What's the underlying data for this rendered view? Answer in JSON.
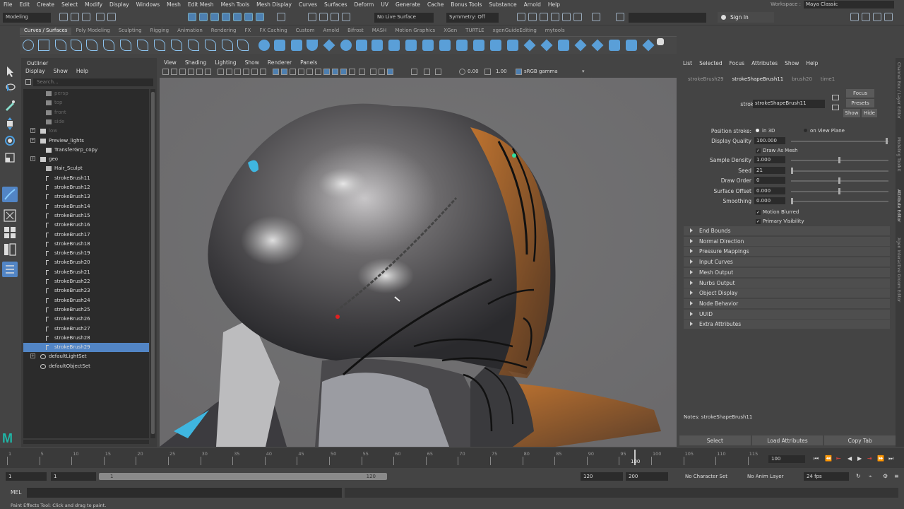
{
  "menubar": [
    "File",
    "Edit",
    "Create",
    "Select",
    "Modify",
    "Display",
    "Windows",
    "Mesh",
    "Edit Mesh",
    "Mesh Tools",
    "Mesh Display",
    "Curves",
    "Surfaces",
    "Deform",
    "UV",
    "Generate",
    "Cache",
    "Bonus Tools",
    "Substance",
    "Arnold",
    "Help"
  ],
  "workspace": {
    "label": "Workspace :",
    "value": "Maya Classic"
  },
  "status": {
    "mode": "Modeling",
    "live_surface": "No Live Surface",
    "symmetry": "Symmetry: Off",
    "signin": "Sign In"
  },
  "shelf_tabs": [
    "Curves / Surfaces",
    "Poly Modeling",
    "Sculpting",
    "Rigging",
    "Animation",
    "Rendering",
    "FX",
    "FX Caching",
    "Custom",
    "Arnold",
    "Bifrost",
    "MASH",
    "Motion Graphics",
    "XGen",
    "TURTLE",
    "xgenGuideEditing",
    "mytools"
  ],
  "outliner": {
    "title": "Outliner",
    "menu": [
      "Display",
      "Show",
      "Help"
    ],
    "search_placeholder": "Search...",
    "items": [
      {
        "label": "persp",
        "dim": true,
        "indent": 1,
        "icon": "camera"
      },
      {
        "label": "top",
        "dim": true,
        "indent": 1,
        "icon": "camera"
      },
      {
        "label": "front",
        "dim": true,
        "indent": 1,
        "icon": "camera"
      },
      {
        "label": "side",
        "dim": true,
        "indent": 1,
        "icon": "camera"
      },
      {
        "label": "low",
        "dim": true,
        "indent": 0,
        "icon": "group",
        "expand": true
      },
      {
        "label": "Preview_lights",
        "dim": false,
        "indent": 0,
        "icon": "group",
        "expand": true
      },
      {
        "label": "TransferGrp_copy",
        "dim": false,
        "indent": 1,
        "icon": "group"
      },
      {
        "label": "geo",
        "dim": false,
        "indent": 0,
        "icon": "group",
        "expand": true
      },
      {
        "label": "Hair_Sculpt",
        "dim": false,
        "indent": 1,
        "icon": "transform"
      },
      {
        "label": "strokeBrush11",
        "dim": false,
        "indent": 1,
        "icon": "stroke"
      },
      {
        "label": "strokeBrush12",
        "dim": false,
        "indent": 1,
        "icon": "stroke"
      },
      {
        "label": "strokeBrush13",
        "dim": false,
        "indent": 1,
        "icon": "stroke"
      },
      {
        "label": "strokeBrush14",
        "dim": false,
        "indent": 1,
        "icon": "stroke"
      },
      {
        "label": "strokeBrush15",
        "dim": false,
        "indent": 1,
        "icon": "stroke"
      },
      {
        "label": "strokeBrush16",
        "dim": false,
        "indent": 1,
        "icon": "stroke"
      },
      {
        "label": "strokeBrush17",
        "dim": false,
        "indent": 1,
        "icon": "stroke"
      },
      {
        "label": "strokeBrush18",
        "dim": false,
        "indent": 1,
        "icon": "stroke"
      },
      {
        "label": "strokeBrush19",
        "dim": false,
        "indent": 1,
        "icon": "stroke"
      },
      {
        "label": "strokeBrush20",
        "dim": false,
        "indent": 1,
        "icon": "stroke"
      },
      {
        "label": "strokeBrush21",
        "dim": false,
        "indent": 1,
        "icon": "stroke"
      },
      {
        "label": "strokeBrush22",
        "dim": false,
        "indent": 1,
        "icon": "stroke"
      },
      {
        "label": "strokeBrush23",
        "dim": false,
        "indent": 1,
        "icon": "stroke"
      },
      {
        "label": "strokeBrush24",
        "dim": false,
        "indent": 1,
        "icon": "stroke"
      },
      {
        "label": "strokeBrush25",
        "dim": false,
        "indent": 1,
        "icon": "stroke"
      },
      {
        "label": "strokeBrush26",
        "dim": false,
        "indent": 1,
        "icon": "stroke"
      },
      {
        "label": "strokeBrush27",
        "dim": false,
        "indent": 1,
        "icon": "stroke"
      },
      {
        "label": "strokeBrush28",
        "dim": false,
        "indent": 1,
        "icon": "stroke"
      },
      {
        "label": "strokeBrush29",
        "dim": false,
        "indent": 1,
        "icon": "stroke",
        "selected": true
      },
      {
        "label": "defaultLightSet",
        "dim": false,
        "indent": 0,
        "icon": "set",
        "expand": true
      },
      {
        "label": "defaultObjectSet",
        "dim": false,
        "indent": 0,
        "icon": "set"
      }
    ]
  },
  "viewport": {
    "menu": [
      "View",
      "Shading",
      "Lighting",
      "Show",
      "Renderer",
      "Panels"
    ],
    "val1": "0.00",
    "val2": "1.00",
    "colorspace": "sRGB gamma"
  },
  "attr": {
    "menu": [
      "List",
      "Selected",
      "Focus",
      "Attributes",
      "Show",
      "Help"
    ],
    "tabs": [
      "strokeBrush29",
      "strokeShapeBrush11",
      "brush20",
      "time1"
    ],
    "stroke_label": "stroke:",
    "stroke_value": "strokeShapeBrush11",
    "focus": "Focus",
    "presets": "Presets",
    "show": "Show",
    "hide": "Hide",
    "position_stroke_label": "Position stroke:",
    "in3d": "in 3D",
    "onview": "on View Plane",
    "fields": [
      {
        "label": "Display Quality",
        "value": "100.000",
        "slider": 1.0
      },
      {
        "label": "Sample Density",
        "value": "1.000",
        "slider": 0.5
      },
      {
        "label": "Seed",
        "value": "21",
        "slider": 0.0
      },
      {
        "label": "Draw Order",
        "value": "0",
        "slider": 0.5
      },
      {
        "label": "Surface Offset",
        "value": "0.000",
        "slider": 0.5
      },
      {
        "label": "Smoothing",
        "value": "0.000",
        "slider": 0.0
      }
    ],
    "draw_as_mesh": "Draw As Mesh",
    "motion_blurred": "Motion Blurred",
    "primary_visibility": "Primary Visibility",
    "sections": [
      "End Bounds",
      "Normal Direction",
      "Pressure Mappings",
      "Input Curves",
      "Mesh Output",
      "Nurbs Output",
      "Object Display",
      "Node Behavior",
      "UUID",
      "Extra Attributes"
    ],
    "notes": "Notes:  strokeShapeBrush11",
    "buttons": [
      "Select",
      "Load Attributes",
      "Copy Tab"
    ]
  },
  "side_tabs": [
    "Channel Box / Layer Editor",
    "Modeling Toolkit",
    "Attribute Editor",
    "Xgen Interactive Groom Editor"
  ],
  "timeline": {
    "labels": [
      "1",
      "5",
      "10",
      "15",
      "20",
      "25",
      "30",
      "35",
      "40",
      "45",
      "50",
      "55",
      "60",
      "65",
      "70",
      "75",
      "80",
      "85",
      "90",
      "95",
      "100",
      "105",
      "110",
      "115"
    ],
    "current": "100",
    "current_field": "100"
  },
  "range": {
    "start": "1",
    "inner_start": "1",
    "bar_start": "1",
    "bar_end": "120",
    "end": "120",
    "anim_end": "200",
    "charset": "No Character Set",
    "animlayer": "No Anim Layer",
    "fps": "24 fps"
  },
  "cmd": {
    "mel": "MEL"
  },
  "helpline": "Paint Effects Tool: Click and drag to paint.",
  "colors": {
    "selected": "#5285c5",
    "accent": "#4d7fb0",
    "maya": "#1fb5a6"
  }
}
